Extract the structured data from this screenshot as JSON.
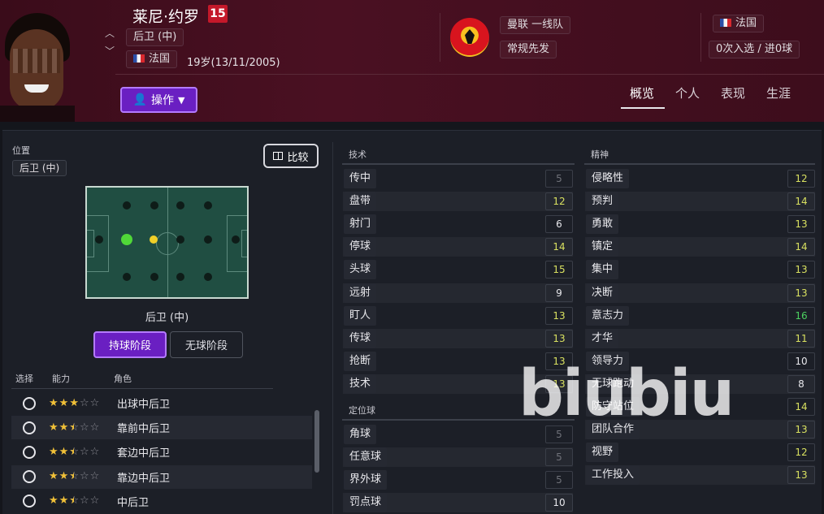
{
  "header": {
    "player_name": "莱尼·约罗",
    "squad_number": "15",
    "position_pill": "后卫 (中)",
    "nationality": "法国",
    "age": "19岁(13/11/2005)",
    "action_button": "操作",
    "club_team": "曼联 一线队",
    "squad_status": "常规先发",
    "national_team": "法国",
    "caps_goals": "0次入选 / 进0球",
    "colors": {
      "header_bg": "#4a1022",
      "accent": "#6a1fc2",
      "number_badge": "#c4182a"
    }
  },
  "tabs": [
    {
      "label": "概览",
      "active": true
    },
    {
      "label": "个人",
      "active": false
    },
    {
      "label": "表现",
      "active": false
    },
    {
      "label": "生涯",
      "active": false
    }
  ],
  "position_panel": {
    "label": "位置",
    "position_pill": "后卫 (中)",
    "compare_button": "比较",
    "pitch_caption": "后卫 (中)",
    "phase_in_possession": "持球阶段",
    "phase_out_possession": "无球阶段"
  },
  "roles": {
    "headers": {
      "select": "选择",
      "ability": "能力",
      "role": "角色"
    },
    "items": [
      {
        "name": "出球中后卫",
        "stars": 3.0
      },
      {
        "name": "靠前中后卫",
        "stars": 2.5
      },
      {
        "name": "套边中后卫",
        "stars": 2.5
      },
      {
        "name": "靠边中后卫",
        "stars": 2.5
      },
      {
        "name": "中后卫",
        "stars": 2.5
      }
    ]
  },
  "attributes": {
    "technical_label": "技术",
    "technical": [
      {
        "name": "传中",
        "value": "5"
      },
      {
        "name": "盘带",
        "value": "12"
      },
      {
        "name": "射门",
        "value": "6"
      },
      {
        "name": "停球",
        "value": "14"
      },
      {
        "name": "头球",
        "value": "15"
      },
      {
        "name": "远射",
        "value": "9"
      },
      {
        "name": "盯人",
        "value": "13"
      },
      {
        "name": "传球",
        "value": "13"
      },
      {
        "name": "抢断",
        "value": "13"
      },
      {
        "name": "技术",
        "value": "13"
      }
    ],
    "set_pieces_label": "定位球",
    "set_pieces": [
      {
        "name": "角球",
        "value": "5"
      },
      {
        "name": "任意球",
        "value": "5"
      },
      {
        "name": "界外球",
        "value": "5"
      },
      {
        "name": "罚点球",
        "value": "10"
      }
    ],
    "mental_label": "精神",
    "mental": [
      {
        "name": "侵略性",
        "value": "12"
      },
      {
        "name": "预判",
        "value": "14"
      },
      {
        "name": "勇敢",
        "value": "13"
      },
      {
        "name": "镇定",
        "value": "14"
      },
      {
        "name": "集中",
        "value": "13"
      },
      {
        "name": "决断",
        "value": "13"
      },
      {
        "name": "意志力",
        "value": "16"
      },
      {
        "name": "才华",
        "value": "11"
      },
      {
        "name": "领导力",
        "value": "10"
      },
      {
        "name": "无球跑动",
        "value": "8"
      },
      {
        "name": "防守站位",
        "value": "14"
      },
      {
        "name": "团队合作",
        "value": "13"
      },
      {
        "name": "视野",
        "value": "12"
      },
      {
        "name": "工作投入",
        "value": "13"
      }
    ],
    "value_colors": {
      "low": "#70727a",
      "mid": "#e8e8ec",
      "good": "#d8e060",
      "high": "#4cd060"
    }
  },
  "watermark": "biubiu"
}
